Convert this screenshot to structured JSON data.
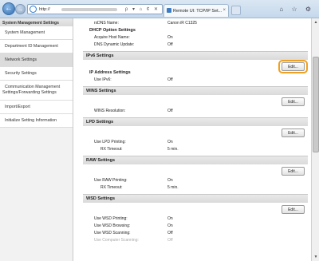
{
  "browser": {
    "back_glyph": "←",
    "forward_glyph": "→",
    "url_prefix": "http://",
    "address_tools": "ρ ▾ ⌂ ¢ ✕",
    "tab_title": "Remote UI: TCP/IP Set...",
    "tab_close": "×",
    "right_icons": "⌂ ☆ ⚙"
  },
  "sidebar": {
    "header": "System Management Settings",
    "items": [
      {
        "label": "System Management"
      },
      {
        "label": "Department ID Management"
      },
      {
        "label": "Network Settings"
      },
      {
        "label": "Security Settings"
      },
      {
        "label_line1": "Communication Management",
        "label_line2": "Settings/Forwarding Settings"
      },
      {
        "label": "Import/Export"
      },
      {
        "label": "Initialize Setting Information"
      }
    ]
  },
  "content": {
    "rdns": {
      "label": "rxDNS Name:",
      "value": "Canon iR C1325"
    },
    "dhcp": {
      "title": "DHCP Option Settings",
      "rows": [
        {
          "label": "Acquire Host Name:",
          "value": "On"
        },
        {
          "label": "DNS Dynamic Update:",
          "value": "Off"
        }
      ]
    },
    "ipv6": {
      "title": "IPv6 Settings",
      "edit": "Edit...",
      "subtitle": "IP Address Settings",
      "rows": [
        {
          "label": "Use IPv6:",
          "value": "Off"
        }
      ]
    },
    "wins": {
      "title": "WINS Settings",
      "edit": "Edit...",
      "rows": [
        {
          "label": "WINS Resolution:",
          "value": "Off"
        }
      ]
    },
    "lpd": {
      "title": "LPD Settings",
      "edit": "Edit...",
      "rows": [
        {
          "label": "Use LPD Printing:",
          "value": "On"
        },
        {
          "label": "RX Timeout:",
          "value": "5 min."
        }
      ]
    },
    "raw": {
      "title": "RAW Settings",
      "edit": "Edit...",
      "rows": [
        {
          "label": "Use RAW Printing:",
          "value": "On"
        },
        {
          "label": "RX Timeout:",
          "value": "5 min."
        }
      ]
    },
    "wsd": {
      "title": "WSD Settings",
      "edit": "Edit...",
      "rows": [
        {
          "label": "Use WSD Printing:",
          "value": "On"
        },
        {
          "label": "Use WSD Browsing:",
          "value": "On"
        },
        {
          "label": "Use WSD Scanning:",
          "value": "Off"
        },
        {
          "label": "Use Computer Scanning:",
          "value": "Off"
        }
      ]
    }
  },
  "colors": {
    "highlight": "#f0a020",
    "active_nav": "#dcdcdc",
    "section_header": "#e0e0e0"
  }
}
